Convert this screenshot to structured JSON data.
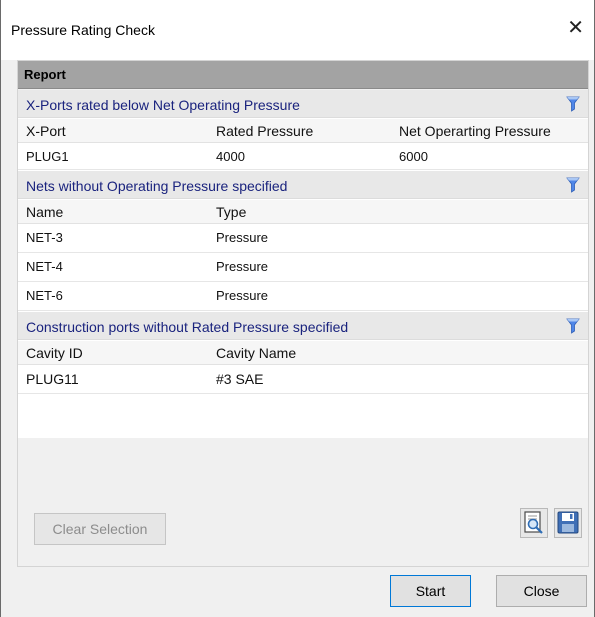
{
  "window": {
    "title": "Pressure Rating Check"
  },
  "report": {
    "header": "Report",
    "sections": [
      {
        "title": "X-Ports rated below Net Operating Pressure",
        "columns": [
          "X-Port",
          "Rated Pressure",
          "Net Operarting Pressure"
        ],
        "rows": [
          [
            "PLUG1",
            "4000",
            "6000"
          ]
        ]
      },
      {
        "title": "Nets without Operating Pressure specified",
        "columns": [
          "Name",
          "Type"
        ],
        "rows": [
          [
            "NET-3",
            "Pressure"
          ],
          [
            "NET-4",
            "Pressure"
          ],
          [
            "NET-6",
            "Pressure"
          ]
        ]
      },
      {
        "title": "Construction ports without Rated Pressure specified",
        "columns": [
          "Cavity ID",
          "Cavity Name"
        ],
        "rows": [
          [
            "PLUG11",
            "#3 SAE"
          ]
        ]
      }
    ]
  },
  "buttons": {
    "clear_selection": "Clear Selection",
    "start": "Start",
    "close": "Close"
  },
  "icons": {
    "filter": "filter-funnel-icon",
    "preview": "print-preview-icon",
    "save": "save-icon",
    "close": "close-icon"
  },
  "colors": {
    "section_text": "#1a237e",
    "report_header_bg": "#a3a3a3",
    "funnel": "#4f86e8"
  }
}
